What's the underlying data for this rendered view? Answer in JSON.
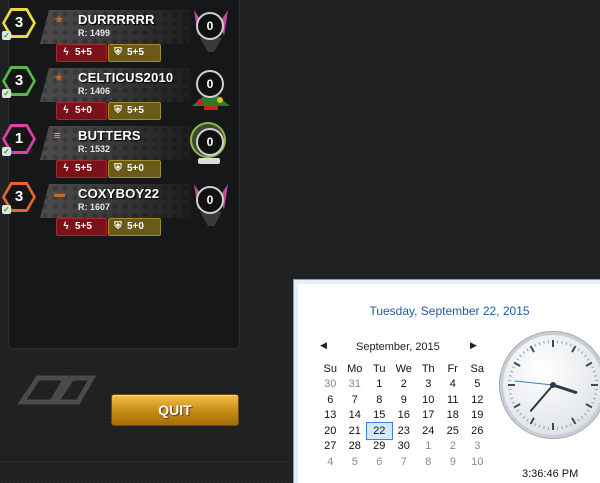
{
  "players": [
    {
      "level": "3",
      "level_color": "#e8d84a",
      "name": "DURRRRRR",
      "rating": "R: 1499",
      "attack": "5+5",
      "defense": "5+5",
      "score": "0",
      "rank_icon": "star-rank-icon",
      "avatar_icon": "robot-horns-icon"
    },
    {
      "level": "3",
      "level_color": "#58b948",
      "name": "CELTICUS2010",
      "rating": "R: 1406",
      "attack": "5+0",
      "defense": "5+5",
      "score": "0",
      "rank_icon": "star-rank-icon",
      "avatar_icon": "snowman-christmas-icon"
    },
    {
      "level": "1",
      "level_color": "#e040a8",
      "name": "BUTTERS",
      "rating": "R: 1532",
      "attack": "5+5",
      "defense": "5+0",
      "score": "0",
      "rank_icon": "chevron-rank-icon",
      "avatar_icon": "green-goggle-robot-icon"
    },
    {
      "level": "3",
      "level_color": "#e8662a",
      "name": "COXYBOY22",
      "rating": "R: 1607",
      "attack": "5+5",
      "defense": "5+0",
      "score": "0",
      "rank_icon": "bar-rank-icon",
      "avatar_icon": "robot-horns-icon"
    }
  ],
  "quit_label": "QUIT",
  "logo_icon": "game-logo-icon",
  "clock": {
    "date_header": "Tuesday, September 22, 2015",
    "month": "September, 2015",
    "weekdays": [
      "Su",
      "Mo",
      "Tu",
      "We",
      "Th",
      "Fr",
      "Sa"
    ],
    "weeks": [
      [
        "30",
        "31",
        "1",
        "2",
        "3",
        "4",
        "5"
      ],
      [
        "6",
        "7",
        "8",
        "9",
        "10",
        "11",
        "12"
      ],
      [
        "13",
        "14",
        "15",
        "16",
        "17",
        "18",
        "19"
      ],
      [
        "20",
        "21",
        "22",
        "23",
        "24",
        "25",
        "26"
      ],
      [
        "27",
        "28",
        "29",
        "30",
        "1",
        "2",
        "3"
      ],
      [
        "4",
        "5",
        "6",
        "7",
        "8",
        "9",
        "10"
      ]
    ],
    "selected_day": "22",
    "time": "3:36:46 PM",
    "hands": {
      "hour": 3.6,
      "minute": 36.77,
      "second": 46
    }
  }
}
